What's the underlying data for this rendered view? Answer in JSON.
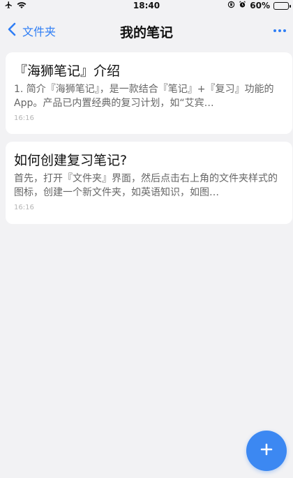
{
  "status_bar": {
    "time": "18:40",
    "battery_percent": "60%",
    "battery_level": 0.6,
    "icons": [
      "airplane-icon",
      "wifi-icon",
      "orientation-lock-icon",
      "alarm-icon",
      "battery-icon"
    ]
  },
  "nav": {
    "back_label": "文件夹",
    "title": "我的笔记",
    "more_icon": "more-dots-icon"
  },
  "notes": [
    {
      "title": "『海狮笔记』介绍",
      "preview": "1. 简介『海狮笔记』，是一款结合『笔记』+『复习』功能的App。产品已内置经典的复习计划，如“艾宾…",
      "time": "16:16"
    },
    {
      "title": "如何创建复习笔记?",
      "preview": "首先，打开『文件夹』界面，然后点击右上角的文件夹样式的图标，创建一个新文件夹，如英语知识，如图…",
      "time": "16:16"
    }
  ],
  "fab": {
    "icon": "plus-icon"
  },
  "colors": {
    "accent": "#2f7ef5",
    "fab": "#3c88f2",
    "background": "#f2f2f4",
    "battery": "#f3c23a"
  }
}
